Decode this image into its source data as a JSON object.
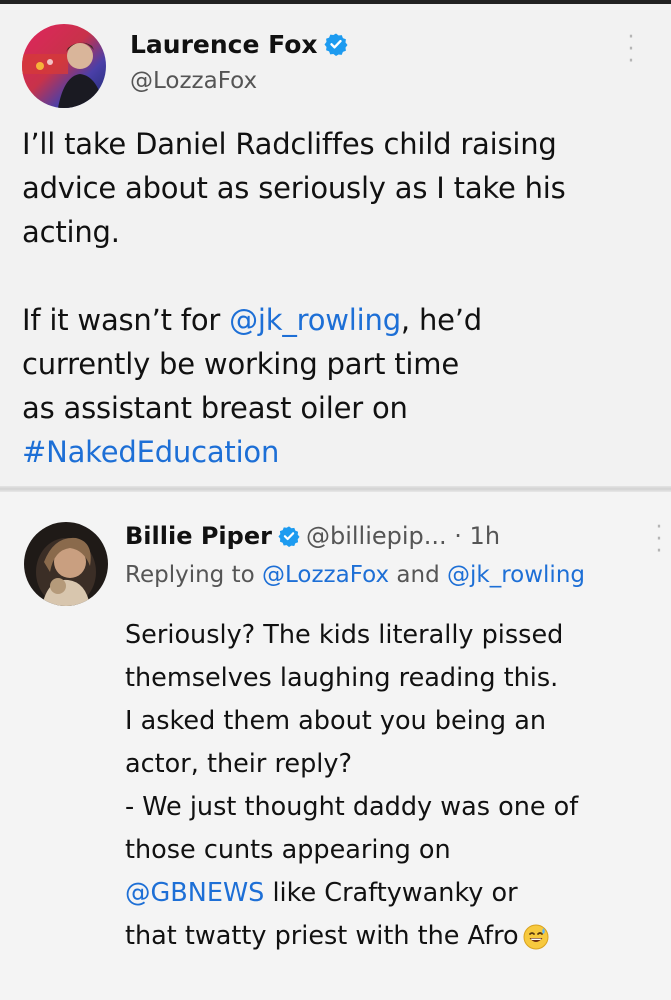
{
  "main_tweet": {
    "author_name": "Laurence Fox",
    "author_handle": "@LozzaFox",
    "lines": [
      [
        {
          "t": "I’ll take Daniel Radcliffes child raising"
        }
      ],
      [
        {
          "t": "advice about as seriously as I take his"
        }
      ],
      [
        {
          "t": "acting."
        }
      ],
      [
        {
          "t": ""
        }
      ],
      [
        {
          "t": "If it wasn’t for "
        },
        {
          "t": "@jk_rowling",
          "link": true
        },
        {
          "t": ", he’d"
        }
      ],
      [
        {
          "t": "currently be working part time"
        }
      ],
      [
        {
          "t": "as assistant breast oiler on"
        }
      ],
      [
        {
          "t": "#NakedEducation",
          "link": true
        }
      ]
    ]
  },
  "reply_tweet": {
    "author_name": "Billie Piper",
    "author_handle": "@billiepip...",
    "time": " · 1h",
    "replying_prefix": "Replying to ",
    "replying_to_1": "@LozzaFox",
    "replying_and": " and ",
    "replying_to_2": "@jk_rowling",
    "lines": [
      [
        {
          "t": "Seriously? The kids literally pissed"
        }
      ],
      [
        {
          "t": "themselves laughing reading this."
        }
      ],
      [
        {
          "t": "I asked them about you being an"
        }
      ],
      [
        {
          "t": "actor, their reply?"
        }
      ],
      [
        {
          "t": "- We just thought daddy was one of"
        }
      ],
      [
        {
          "t": "those cunts appearing on"
        }
      ],
      [
        {
          "t": "@GBNEWS",
          "link": true
        },
        {
          "t": "  like Craftywanky or"
        }
      ],
      [
        {
          "t": "that twatty priest with the Afro"
        },
        {
          "emoji": "grinning-sweat-emoji"
        }
      ]
    ]
  },
  "icons": {
    "verified": "verified-badge-icon",
    "more": "more-vertical-icon",
    "emoji": "grinning-sweat-emoji"
  },
  "colors": {
    "link": "#1d6fd6",
    "verified": "#1d9bf0",
    "muted": "#555555",
    "background": "#f2f2f2"
  }
}
